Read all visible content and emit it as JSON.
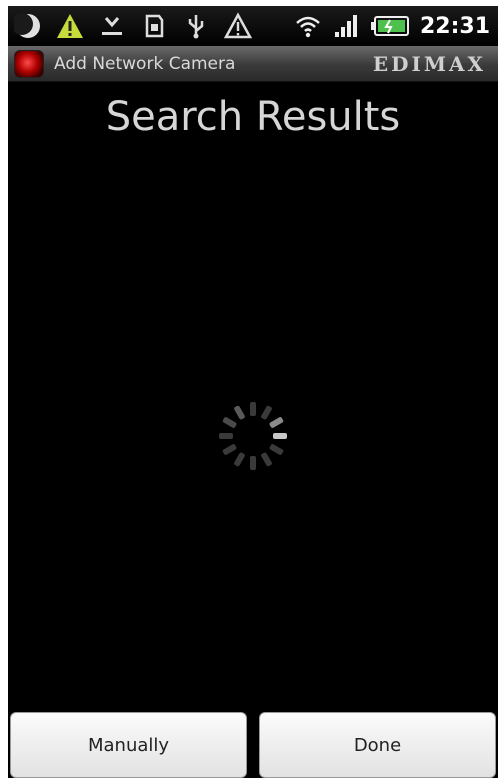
{
  "status_bar": {
    "time": "22:31",
    "icons": [
      "moon-icon",
      "warning-icon",
      "download-icon",
      "sd-card-icon",
      "usb-icon",
      "alert-icon",
      "wifi-icon",
      "signal-icon",
      "battery-icon"
    ]
  },
  "title_bar": {
    "app_title": "Add Network Camera",
    "brand": "EDIMAX"
  },
  "main": {
    "heading": "Search Results"
  },
  "buttons": {
    "manually_label": "Manually",
    "done_label": "Done"
  },
  "colors": {
    "background": "#000000",
    "heading_text": "#d6d6d6",
    "warning": "#c7dc3a"
  }
}
